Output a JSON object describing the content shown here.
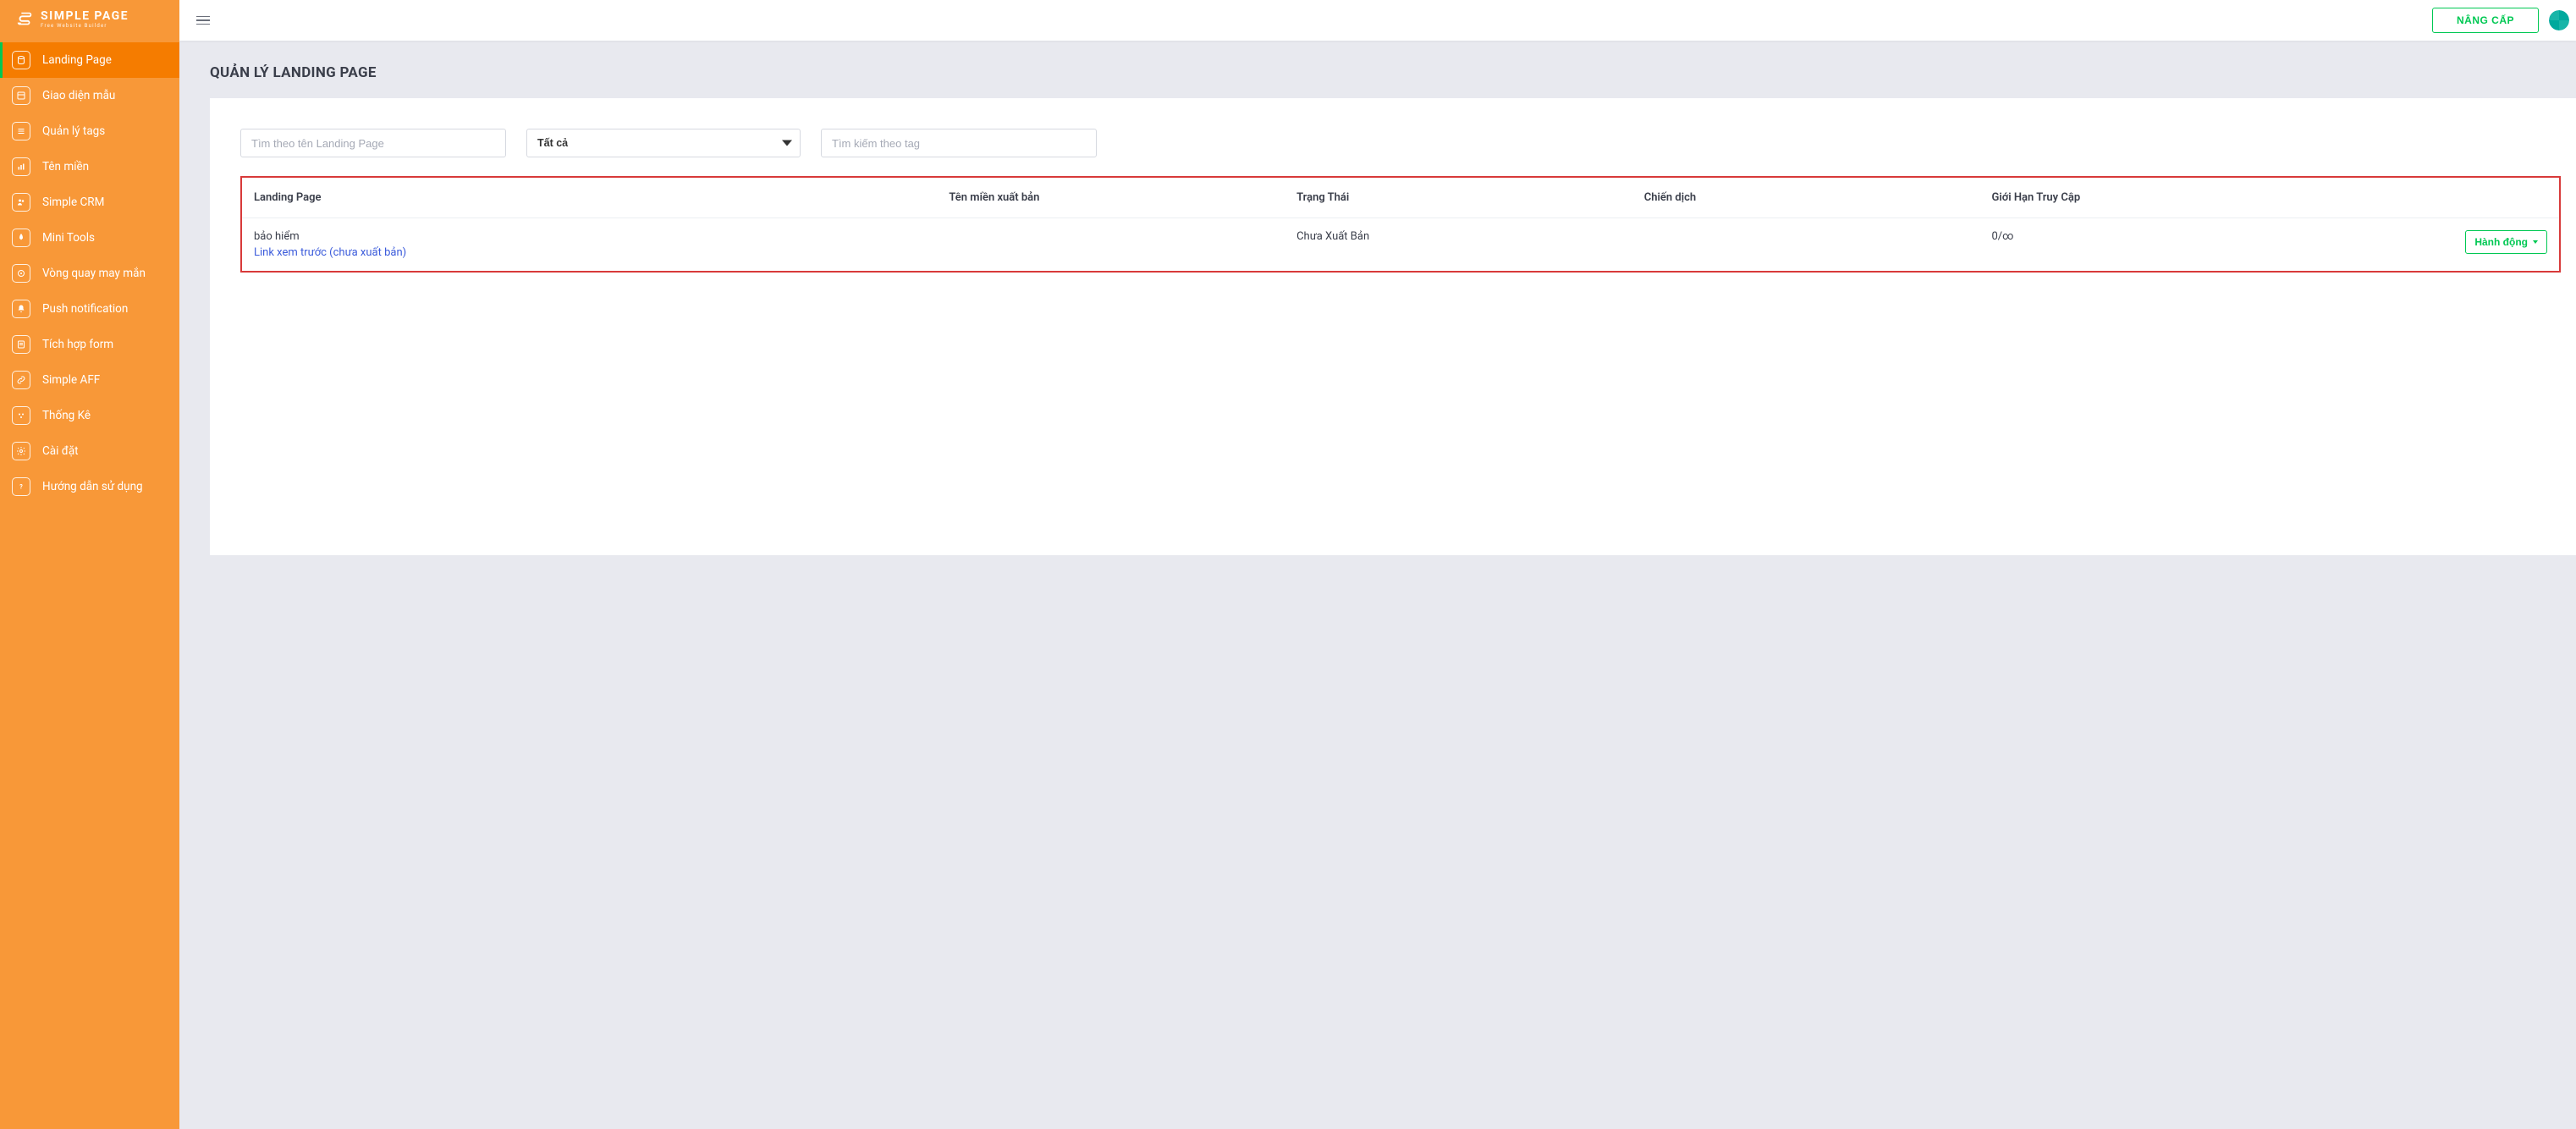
{
  "brand": {
    "title": "SIMPLE PAGE",
    "subtitle": "Free Website Builder"
  },
  "sidebar": {
    "items": [
      {
        "label": "Landing Page",
        "icon": "database"
      },
      {
        "label": "Giao diện mẫu",
        "icon": "template"
      },
      {
        "label": "Quản lý tags",
        "icon": "list"
      },
      {
        "label": "Tên miền",
        "icon": "chart"
      },
      {
        "label": "Simple CRM",
        "icon": "users"
      },
      {
        "label": "Mini Tools",
        "icon": "rocket"
      },
      {
        "label": "Vòng quay may mắn",
        "icon": "circle"
      },
      {
        "label": "Push notification",
        "icon": "bell"
      },
      {
        "label": "Tích hợp form",
        "icon": "form"
      },
      {
        "label": "Simple AFF",
        "icon": "link"
      },
      {
        "label": "Thống Kê",
        "icon": "stats"
      },
      {
        "label": "Cài đặt",
        "icon": "gear"
      },
      {
        "label": "Hướng dẫn sử dụng",
        "icon": "help"
      }
    ]
  },
  "header": {
    "upgrade": "NÂNG CẤP"
  },
  "page": {
    "title": "QUẢN LÝ LANDING PAGE"
  },
  "filters": {
    "search_placeholder": "Tìm theo tên Landing Page",
    "select_value": "Tất cả",
    "tag_placeholder": "Tìm kiếm theo tag"
  },
  "table": {
    "headers": {
      "landing": "Landing Page",
      "domain": "Tên miền xuất bản",
      "status": "Trạng Thái",
      "campaign": "Chiến dịch",
      "limit": "Giới Hạn Truy Cập"
    },
    "rows": [
      {
        "name": "bảo hiểm",
        "preview_link": "Link xem trước (chưa xuất bản)",
        "domain": "",
        "status": "Chưa Xuất Bản",
        "campaign": "",
        "limit": "0/∞",
        "action": "Hành động"
      }
    ]
  }
}
